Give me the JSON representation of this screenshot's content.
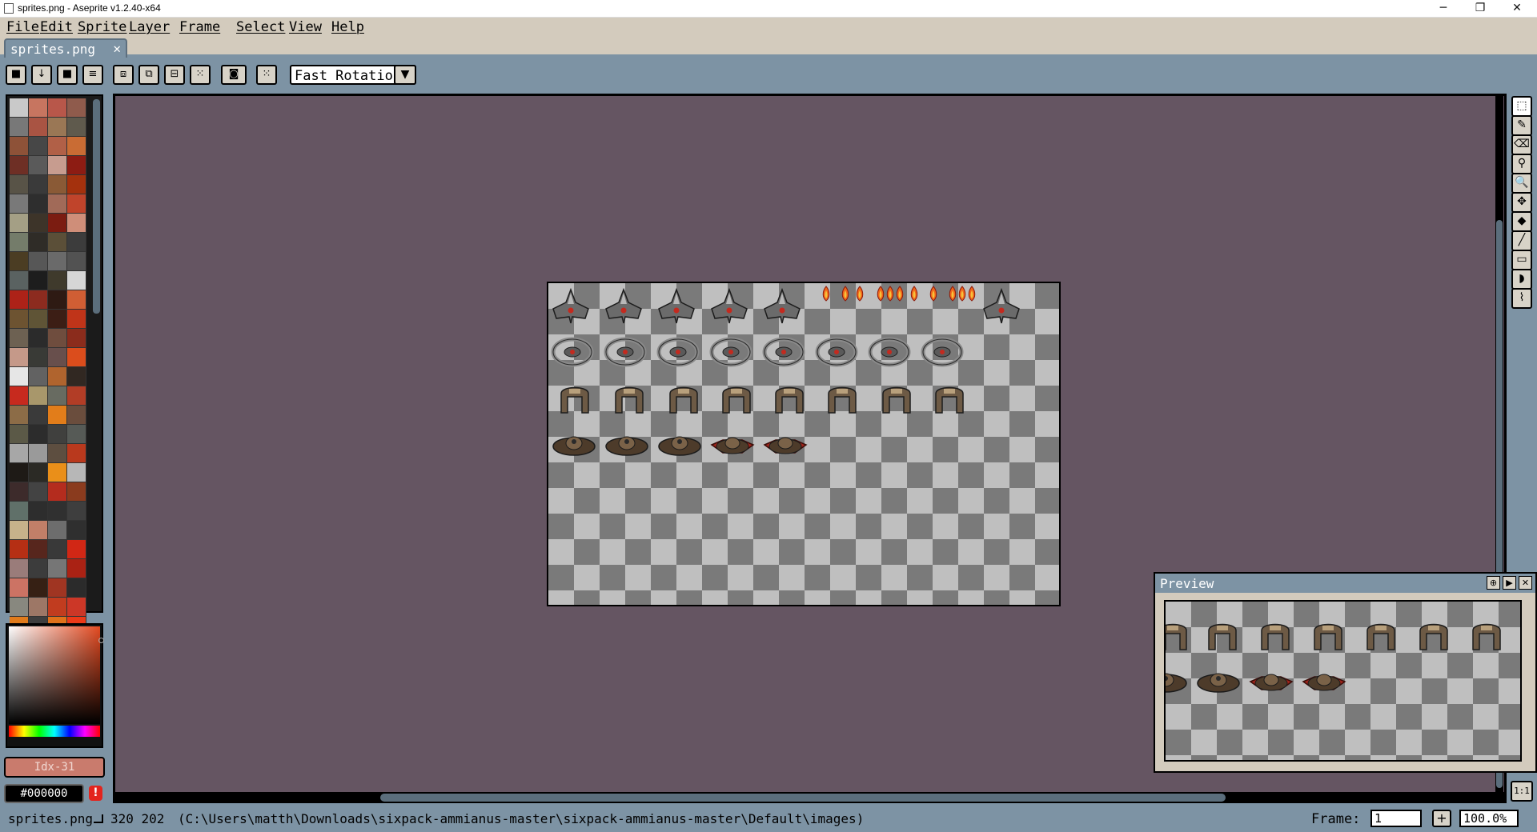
{
  "window": {
    "title": "sprites.png - Aseprite v1.2.40-x64",
    "minimize": "─",
    "restore": "❐",
    "close": "✕"
  },
  "menu": [
    "File",
    "Edit",
    "Sprite",
    "Layer",
    "Frame",
    "Select",
    "View",
    "Help"
  ],
  "tab": {
    "label": "sprites.png",
    "close": "✕"
  },
  "context_bar": {
    "rotation_algorithm": "Fast Rotation",
    "buttons": [
      "lock-icon",
      "move-down-icon",
      "stop-icon",
      "menu-icon",
      "selection-new-icon",
      "selection-add-icon",
      "selection-subtract-icon",
      "selection-intersect-icon",
      "transparent-color-icon",
      "pivot-icon"
    ]
  },
  "palette": {
    "colors": [
      "#c9c9c9",
      "#c77560",
      "#b8574a",
      "#8f5b4c",
      "#787878",
      "#a95443",
      "#9a7755",
      "#5f5a4d",
      "#8e5238",
      "#474747",
      "#b16047",
      "#c96c34",
      "#6e2f25",
      "#5a5a5a",
      "#c79c8f",
      "#8d1c13",
      "#585347",
      "#3a3a3a",
      "#8a5a36",
      "#a4310d",
      "#797979",
      "#2e2e2e",
      "#a16a58",
      "#c0442b",
      "#a49f85",
      "#3d3429",
      "#7b1c11",
      "#cf8e79",
      "#747c6a",
      "#2f2c27",
      "#5b4f38",
      "#3c3c3c",
      "#4b3d23",
      "#575757",
      "#6a6a6a",
      "#525252",
      "#5a6261",
      "#1d1d1d",
      "#3f3a2c",
      "#d6d6d6",
      "#ad2218",
      "#8c2b1f",
      "#2e1a13",
      "#d05e34",
      "#6d5331",
      "#5f5436",
      "#3c1e15",
      "#c03419",
      "#6d6152",
      "#2b2b2b",
      "#6f4d3e",
      "#8b2c1c",
      "#c59989",
      "#393a36",
      "#684f4c",
      "#db4d1c",
      "#e6e6e6",
      "#626262",
      "#b0642e",
      "#312822",
      "#c72a1e",
      "#a8976b",
      "#686b61",
      "#b23d26",
      "#8c6c47",
      "#3a3a3a",
      "#e27d1a",
      "#6a4d3d",
      "#5b5947",
      "#2c2c2c",
      "#40403e",
      "#565a56",
      "#a7a7a7",
      "#9a9a9a",
      "#5d4e40",
      "#b9391d",
      "#1e1a16",
      "#2b2a25",
      "#ea8f19",
      "#b7b7b7",
      "#3d2b2b",
      "#434343",
      "#b42c1e",
      "#8a3b1e",
      "#607069",
      "#2d2d2d",
      "#303030",
      "#3e3e3e",
      "#c7b28b",
      "#c27f68",
      "#6d6d6d",
      "#2f2f2f",
      "#b52f14",
      "#57261d",
      "#393939",
      "#d12715",
      "#9a7c7a",
      "#3c3c3c",
      "#767676",
      "#aa2214",
      "#cc7364",
      "#362014",
      "#a03522",
      "#2b2b2b",
      "#88887f",
      "#9d7766",
      "#c13c1f",
      "#cc3727",
      "#e17b1b",
      "#3e3e3e",
      "#e0711a",
      "#ec3a18"
    ],
    "selected_index_label": "Idx-31"
  },
  "color": {
    "hex": "#000000",
    "warning": "!"
  },
  "tools": [
    {
      "name": "rectangular-marquee-icon",
      "glyph": "⬚"
    },
    {
      "name": "pencil-icon",
      "glyph": "✎"
    },
    {
      "name": "eraser-icon",
      "glyph": "⌫"
    },
    {
      "name": "eyedropper-icon",
      "glyph": "⚲"
    },
    {
      "name": "zoom-icon",
      "glyph": "🔍"
    },
    {
      "name": "move-icon",
      "glyph": "✥"
    },
    {
      "name": "paint-bucket-icon",
      "glyph": "◆"
    },
    {
      "name": "line-icon",
      "glyph": "╱"
    },
    {
      "name": "rectangle-icon",
      "glyph": "▭"
    },
    {
      "name": "contour-icon",
      "glyph": "◗"
    },
    {
      "name": "blur-icon",
      "glyph": "⌇"
    }
  ],
  "zoom_reset": "1:1",
  "preview": {
    "title": "Preview"
  },
  "status": {
    "filename": "sprites.png",
    "dimensions": "320 202",
    "path": "(C:\\Users\\matth\\Downloads\\sixpack-ammianus-master\\sixpack-ammianus-master\\Default\\images)",
    "frame_label": "Frame:",
    "frame_value": "1",
    "add_frame": "+",
    "zoom": "100.0%"
  }
}
